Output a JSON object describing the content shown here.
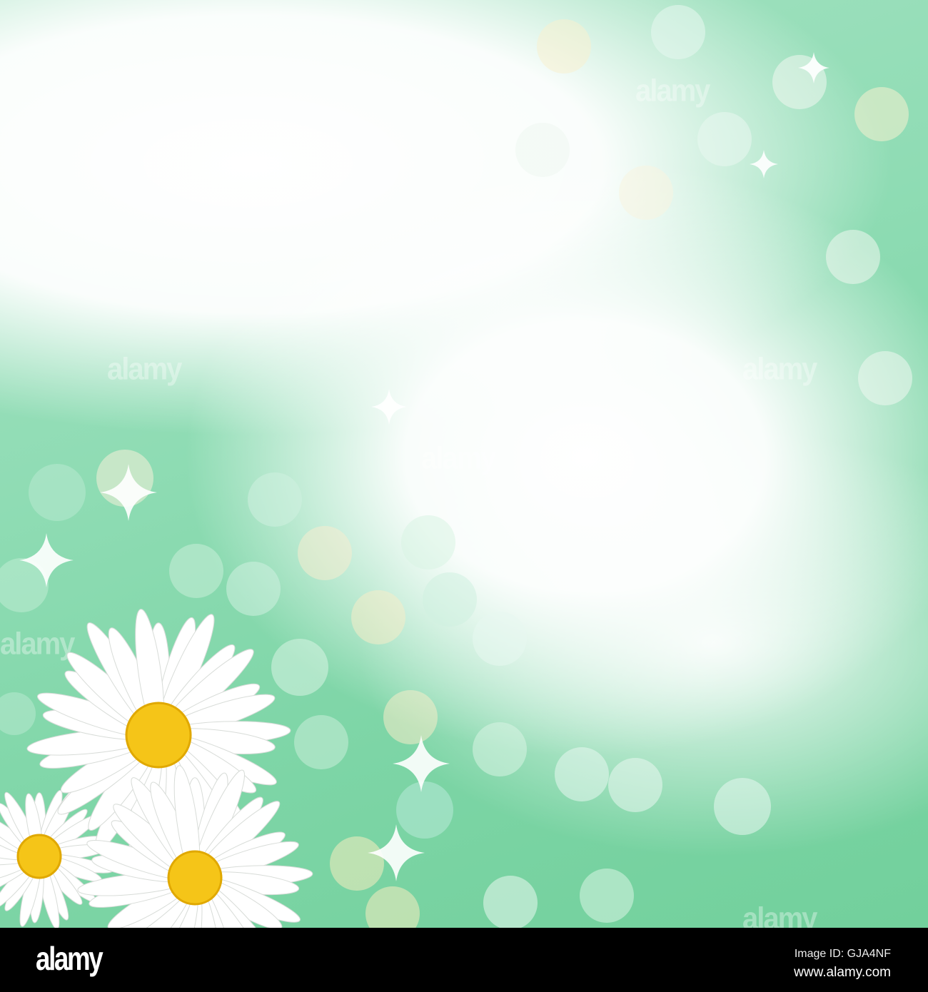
{
  "watermark": "alamy",
  "footer": {
    "logo": "alamy",
    "image_id": "Image ID: GJA4NF",
    "url": "www.alamy.com"
  },
  "colors": {
    "green": "#7dd5a6",
    "petal": "#ffffff",
    "center": "#f5c518"
  }
}
